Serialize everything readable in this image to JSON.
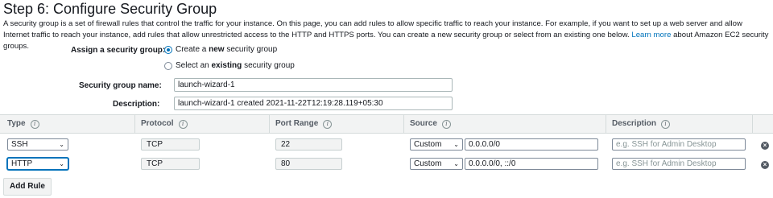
{
  "page": {
    "title": "Step 6: Configure Security Group",
    "intro_text": "A security group is a set of firewall rules that control the traffic for your instance. On this page, you can add rules to allow specific traffic to reach your instance. For example, if you want to set up a web server and allow Internet traffic to reach your instance, add rules that allow unrestricted access to the HTTP and HTTPS ports. You can create a new security group or select from an existing one below.",
    "learn_more_link": "Learn more",
    "intro_suffix": "about Amazon EC2 security groups."
  },
  "form": {
    "assign_label": "Assign a security group:",
    "option_create_prefix": "Create a",
    "option_create_bold": "new",
    "option_create_suffix": "security group",
    "option_select_prefix": "Select an",
    "option_select_bold": "existing",
    "option_select_suffix": "security group",
    "selected_option": "create",
    "name_label": "Security group name:",
    "name_value": "launch-wizard-1",
    "description_label": "Description:",
    "description_value": "launch-wizard-1 created 2021-11-22T12:19:28.119+05:30"
  },
  "table": {
    "columns": [
      {
        "label": "Type",
        "info": "i"
      },
      {
        "label": "Protocol",
        "info": "i"
      },
      {
        "label": "Port Range",
        "info": "i"
      },
      {
        "label": "Source",
        "info": "i"
      },
      {
        "label": "Description",
        "info": "i"
      }
    ],
    "rows": [
      {
        "type": "SSH",
        "protocol": "TCP",
        "port_range": "22",
        "source_mode": "Custom",
        "source_cidr": "0.0.0.0/0",
        "description_placeholder": "e.g. SSH for Admin Desktop",
        "focused": false
      },
      {
        "type": "HTTP",
        "protocol": "TCP",
        "port_range": "80",
        "source_mode": "Custom",
        "source_cidr": "0.0.0.0/0, ::/0",
        "description_placeholder": "e.g. SSH for Admin Desktop",
        "focused": true
      }
    ],
    "chevron_glyph": "⌄",
    "remove_glyph": "×"
  },
  "actions": {
    "add_rule_label": "Add Rule"
  },
  "colors": {
    "link": "#0073bb",
    "header_bg": "#f2f3f3",
    "remove_icon": "#545b64"
  }
}
